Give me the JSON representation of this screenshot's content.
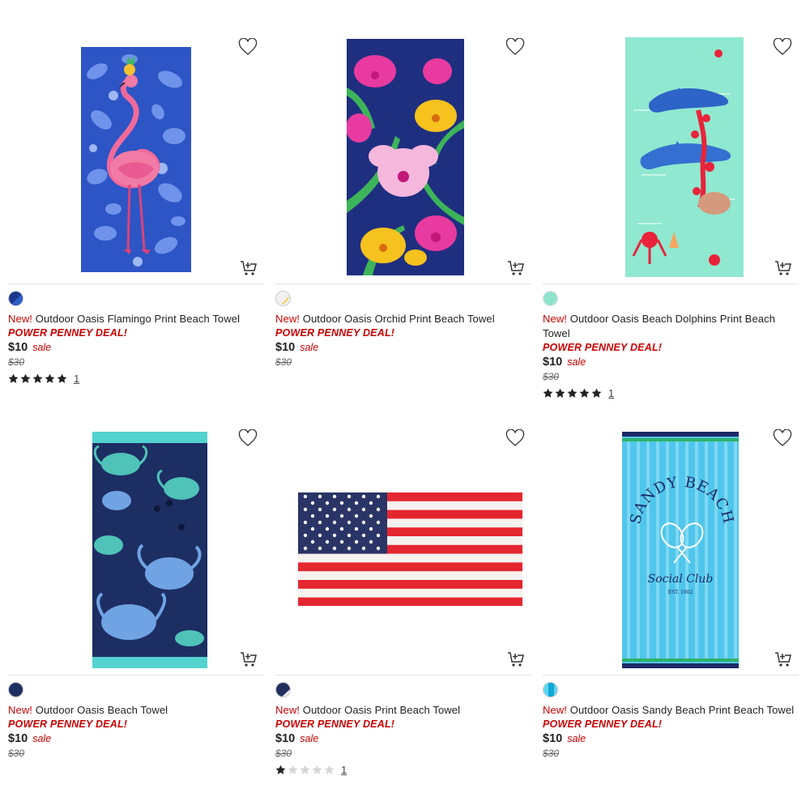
{
  "products": [
    {
      "new_label": "New!",
      "name": "Outdoor Oasis Flamingo Print Beach Towel",
      "deal": "POWER PENNEY DEAL!",
      "price": "$10",
      "sale_label": "sale",
      "original_price": "$30",
      "rating_stars": 5,
      "review_count": "1",
      "swatch_colors": [
        "#2f5fc9",
        "#1b3a8f"
      ],
      "image_description_icon": "flamingo-towel-image"
    },
    {
      "new_label": "New!",
      "name": "Outdoor Oasis Orchid Print Beach Towel",
      "deal": "POWER PENNEY DEAL!",
      "price": "$10",
      "sale_label": "sale",
      "original_price": "$30",
      "rating_stars": null,
      "review_count": null,
      "swatch_colors": [
        "#f0f0f0",
        "#f3c623"
      ],
      "image_description_icon": "orchid-towel-image"
    },
    {
      "new_label": "New!",
      "name": "Outdoor Oasis Beach Dolphins Print Beach Towel",
      "deal": "POWER PENNEY DEAL!",
      "price": "$10",
      "sale_label": "sale",
      "original_price": "$30",
      "rating_stars": 5,
      "review_count": "1",
      "swatch_colors": [
        "#8fe3cc",
        "#8fe3cc"
      ],
      "image_description_icon": "dolphins-towel-image"
    },
    {
      "new_label": "New!",
      "name": "Outdoor Oasis Beach Towel",
      "deal": "POWER PENNEY DEAL!",
      "price": "$10",
      "sale_label": "sale",
      "original_price": "$30",
      "rating_stars": null,
      "review_count": null,
      "swatch_colors": [
        "#1f2f63",
        "#1f2f63"
      ],
      "image_description_icon": "crab-towel-image"
    },
    {
      "new_label": "New!",
      "name": "Outdoor Oasis Print Beach Towel",
      "deal": "POWER PENNEY DEAL!",
      "price": "$10",
      "sale_label": "sale",
      "original_price": "$30",
      "rating_stars": 1,
      "review_count": "1",
      "swatch_colors": [
        "#23305e",
        "#e9e9e9"
      ],
      "image_description_icon": "flag-towel-image"
    },
    {
      "new_label": "New!",
      "name": "Outdoor Oasis Sandy Beach Print Beach Towel",
      "deal": "POWER PENNEY DEAL!",
      "price": "$10",
      "sale_label": "sale",
      "original_price": "$30",
      "rating_stars": null,
      "review_count": null,
      "swatch_colors": [
        "#5ed4ef",
        "#0ea7d6"
      ],
      "image_description_icon": "sandy-beach-towel-image"
    }
  ],
  "towel_texts": {
    "sandy_beach_arc": "SANDY BEACH",
    "social_club": "Social Club",
    "est": "EST. 1902"
  },
  "colors": {
    "accent_red": "#cc0000",
    "star_fill": "#222222",
    "star_empty": "#d6d6d6"
  }
}
